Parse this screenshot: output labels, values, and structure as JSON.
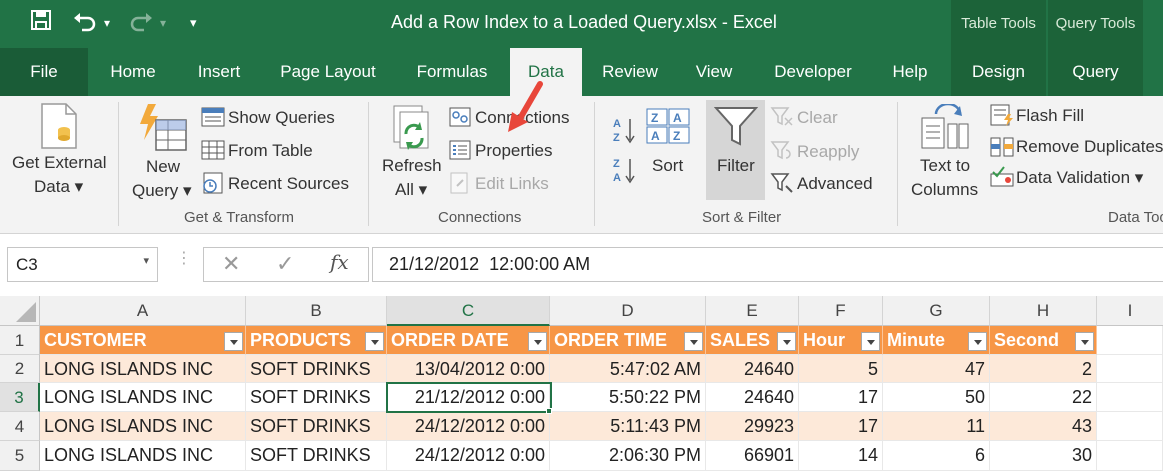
{
  "title_bar": {
    "document_title": "Add a Row Index to a Loaded Query.xlsx  -  Excel",
    "context_table_tools": "Table Tools",
    "context_query_tools": "Query Tools"
  },
  "tabs": {
    "file": "File",
    "home": "Home",
    "insert": "Insert",
    "page_layout": "Page Layout",
    "formulas": "Formulas",
    "data": "Data",
    "review": "Review",
    "view": "View",
    "developer": "Developer",
    "help": "Help",
    "design": "Design",
    "query": "Query"
  },
  "ribbon": {
    "get_external_data": {
      "line1": "Get External",
      "line2": "Data ▾"
    },
    "get_transform": {
      "new_query_line1": "New",
      "new_query_line2": "Query ▾",
      "show_queries": "Show Queries",
      "from_table": "From Table",
      "recent_sources": "Recent Sources",
      "group_label": "Get & Transform"
    },
    "connections": {
      "refresh_line1": "Refresh",
      "refresh_line2": "All ▾",
      "connections": "Connections",
      "properties": "Properties",
      "edit_links": "Edit Links",
      "group_label": "Connections"
    },
    "sort_filter": {
      "sort": "Sort",
      "filter": "Filter",
      "clear": "Clear",
      "reapply": "Reapply",
      "advanced": "Advanced",
      "group_label": "Sort & Filter"
    },
    "data_tools": {
      "text_to_columns_line1": "Text to",
      "text_to_columns_line2": "Columns",
      "flash_fill": "Flash Fill",
      "remove_duplicates": "Remove Duplicates",
      "data_validation": "Data Validation  ▾",
      "group_label": "Data Tools"
    }
  },
  "formula_bar": {
    "name_box": "C3",
    "formula": "21/12/2012  12:00:00 AM"
  },
  "sheet": {
    "columns": [
      "A",
      "B",
      "C",
      "D",
      "E",
      "F",
      "G",
      "H",
      "I"
    ],
    "rows": [
      "1",
      "2",
      "3",
      "4",
      "5"
    ],
    "headers": [
      "CUSTOMER",
      "PRODUCTS",
      "ORDER DATE",
      "ORDER TIME",
      "SALES",
      "Hour",
      "Minute",
      "Second"
    ],
    "data": [
      [
        "LONG ISLANDS INC",
        "SOFT DRINKS",
        "13/04/2012 0:00",
        "5:47:02 AM",
        "24640",
        "5",
        "47",
        "2"
      ],
      [
        "LONG ISLANDS INC",
        "SOFT DRINKS",
        "21/12/2012 0:00",
        "5:50:22 PM",
        "24640",
        "17",
        "50",
        "22"
      ],
      [
        "LONG ISLANDS INC",
        "SOFT DRINKS",
        "24/12/2012 0:00",
        "5:11:43 PM",
        "29923",
        "17",
        "11",
        "43"
      ],
      [
        "LONG ISLANDS INC",
        "SOFT DRINKS",
        "24/12/2012 0:00",
        "2:06:30 PM",
        "66901",
        "14",
        "6",
        "30"
      ]
    ]
  },
  "colors": {
    "excel_green": "#217346",
    "table_header": "#f79646",
    "table_band": "#fde9d9",
    "annotation_arrow": "#e8463a"
  }
}
